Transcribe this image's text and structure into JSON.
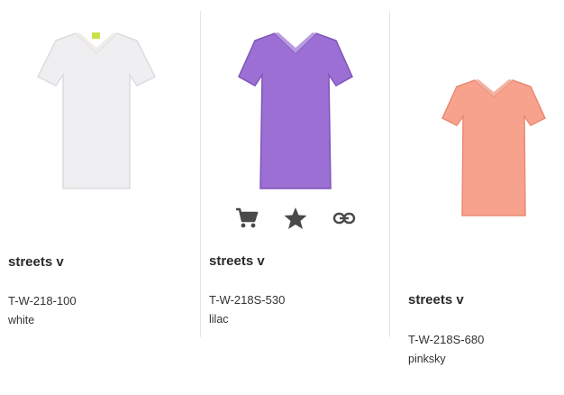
{
  "products": [
    {
      "title": "streets v",
      "sku": "T-W-218-100",
      "color_name": "white",
      "shirt_color": "#efeef0",
      "shirt_shade": "#dcdbe0",
      "trim_color": "#f0ece8"
    },
    {
      "title": "streets v",
      "sku": "T-W-218S-530",
      "color_name": "lilac",
      "shirt_color": "#9b6fd3",
      "shirt_shade": "#7f55b9",
      "trim_color": "#b89be0"
    },
    {
      "title": "streets v",
      "sku": "T-W-218S-680",
      "color_name": "pinksky",
      "shirt_color": "#f7a28c",
      "shirt_shade": "#e98a75",
      "trim_color": "#f2b3a2"
    }
  ],
  "actions": {
    "icons": [
      "cart-icon",
      "star-icon",
      "link-icon"
    ],
    "icon_color": "#4a4a4a"
  }
}
